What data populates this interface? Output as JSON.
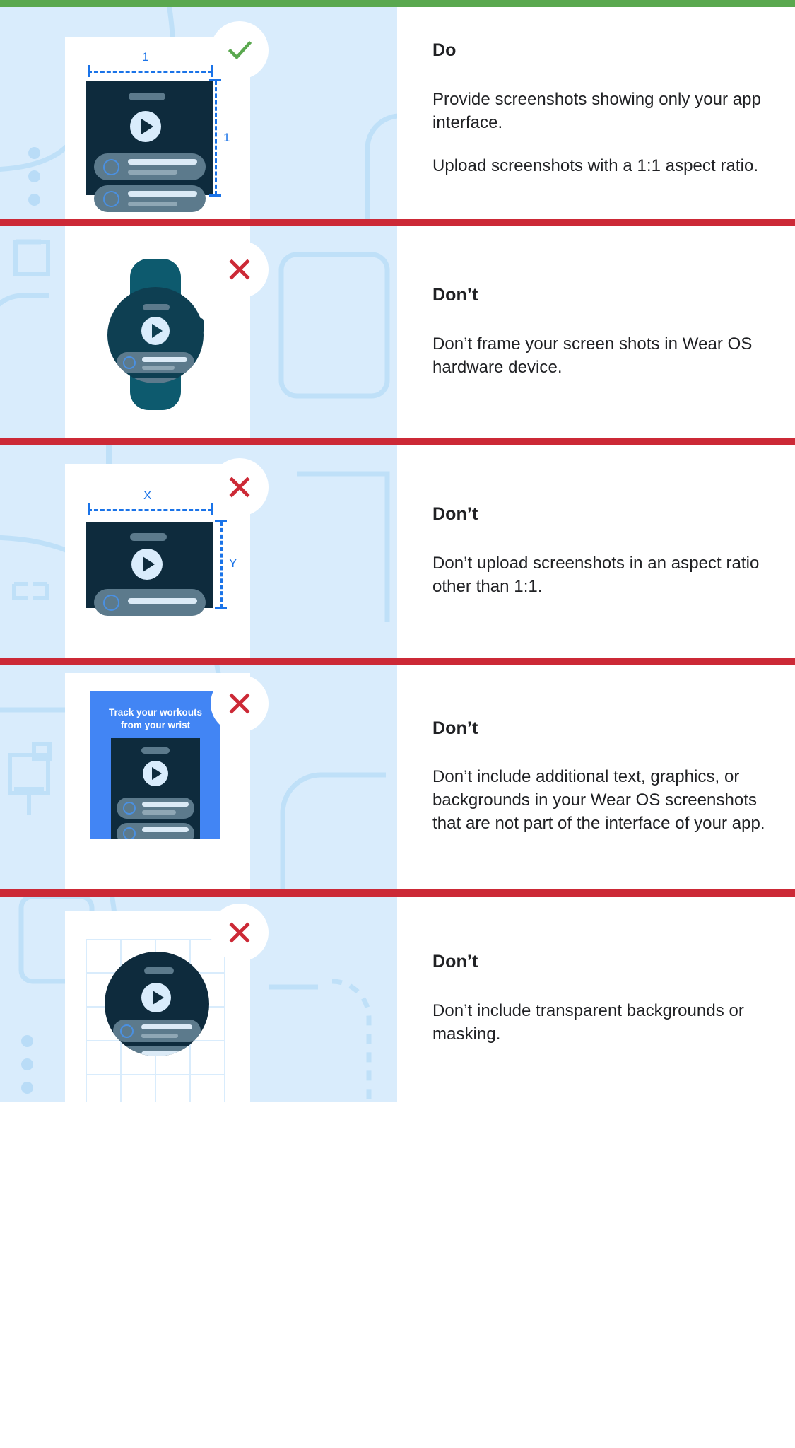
{
  "colors": {
    "rule_do": "#5aa84f",
    "rule_dont": "#cc2936",
    "illus_bg": "#d9ecfc",
    "device_dark": "#0e2b3d",
    "accent_blue": "#1a73e8",
    "promo_blue": "#4285f4",
    "text": "#202124",
    "check_green": "#5aa84f",
    "cross_red": "#cc2936",
    "watch_body": "#0e3f52",
    "watch_band": "#0d5a6e"
  },
  "panels": [
    {
      "id": "do-aspect-ratio",
      "rule_color": "#5aa84f",
      "badge": "check-icon",
      "badge_label": "check",
      "kicker": "Do",
      "paragraphs": [
        "Provide screenshots showing only your app interface.",
        "Upload screenshots with a 1:1 aspect ratio."
      ],
      "dimension_labels": {
        "width": "1",
        "height": "1"
      }
    },
    {
      "id": "dont-hardware-frame",
      "rule_color": "#cc2936",
      "badge": "close-icon",
      "badge_label": "cross",
      "kicker": "Don’t",
      "paragraphs": [
        "Don’t frame your screen shots in Wear OS hardware device."
      ]
    },
    {
      "id": "dont-aspect-ratio",
      "rule_color": "#cc2936",
      "badge": "close-icon",
      "badge_label": "cross",
      "kicker": "Don’t",
      "paragraphs": [
        "Don’t upload screenshots in an aspect ratio other than 1:1."
      ],
      "dimension_labels": {
        "width": "X",
        "height": "Y"
      }
    },
    {
      "id": "dont-extra-graphics",
      "rule_color": "#cc2936",
      "badge": "close-icon",
      "badge_label": "cross",
      "kicker": "Don’t",
      "paragraphs": [
        "Don’t include additional text, graphics, or backgrounds in your Wear OS screenshots that are not part of the interface of your app."
      ],
      "promo": {
        "line1": "Track your workouts",
        "line2": "from your wrist"
      }
    },
    {
      "id": "dont-transparent-background",
      "rule_color": "#cc2936",
      "badge": "close-icon",
      "badge_label": "cross",
      "kicker": "Don’t",
      "paragraphs": [
        "Don’t include transparent backgrounds or masking."
      ]
    }
  ]
}
